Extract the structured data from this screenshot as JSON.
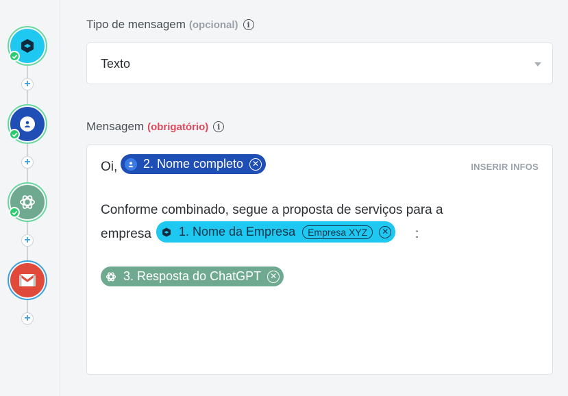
{
  "form": {
    "message_type": {
      "label": "Tipo de mensagem",
      "qualifier": "(opcional)",
      "value": "Texto"
    },
    "message": {
      "label": "Mensagem",
      "qualifier": "(obrigatório)",
      "insert_link": "INSERIR INFOS",
      "greeting": "Oi,",
      "line1": "Conforme combinado, segue a proposta de serviços para a",
      "line2_prefix": "empresa",
      "line2_suffix": ":",
      "chips": {
        "name": "2. Nome completo",
        "company": "1. Nome da Empresa",
        "company_sample": "Empresa XYZ",
        "chatgpt": "3. Resposta do ChatGPT"
      }
    }
  },
  "colors": {
    "cyan": "#1ec8f0",
    "blue": "#1f4fb5",
    "chatgpt_green": "#6ea990",
    "gmail_red": "#e04a3a",
    "check_green": "#2ecc71"
  }
}
